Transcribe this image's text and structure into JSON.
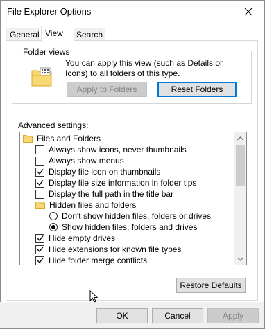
{
  "window": {
    "title": "File Explorer Options"
  },
  "tabs": [
    {
      "label": "General"
    },
    {
      "label": "View"
    },
    {
      "label": "Search"
    }
  ],
  "folder_views": {
    "legend": "Folder views",
    "description": "You can apply this view (such as Details or Icons) to all folders of this type.",
    "apply_label": "Apply to Folders",
    "reset_label": "Reset Folders"
  },
  "advanced": {
    "label": "Advanced settings:",
    "items": [
      {
        "type": "folder",
        "label": "Files and Folders"
      },
      {
        "type": "checkbox",
        "checked": false,
        "label": "Always show icons, never thumbnails"
      },
      {
        "type": "checkbox",
        "checked": false,
        "label": "Always show menus"
      },
      {
        "type": "checkbox",
        "checked": true,
        "label": "Display file icon on thumbnails"
      },
      {
        "type": "checkbox",
        "checked": true,
        "label": "Display file size information in folder tips"
      },
      {
        "type": "checkbox",
        "checked": false,
        "label": "Display the full path in the title bar"
      },
      {
        "type": "folder",
        "label": "Hidden files and folders"
      },
      {
        "type": "radio",
        "checked": false,
        "label": "Don't show hidden files, folders or drives"
      },
      {
        "type": "radio",
        "checked": true,
        "label": "Show hidden files, folders and drives"
      },
      {
        "type": "checkbox",
        "checked": true,
        "label": "Hide empty drives"
      },
      {
        "type": "checkbox",
        "checked": true,
        "label": "Hide extensions for known file types"
      },
      {
        "type": "checkbox",
        "checked": true,
        "label": "Hide folder merge conflicts"
      }
    ]
  },
  "buttons": {
    "restore": "Restore Defaults",
    "ok": "OK",
    "cancel": "Cancel",
    "apply": "Apply"
  },
  "colors": {
    "focus_border": "#0078d7",
    "folder": "#f8d775"
  }
}
